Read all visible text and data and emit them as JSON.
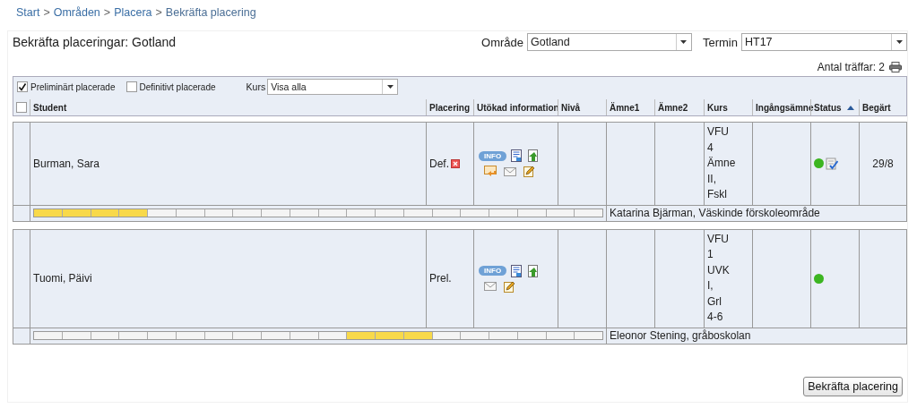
{
  "breadcrumb": [
    {
      "label": "Start",
      "link": true
    },
    {
      "separator": ">",
      "label": "Områden",
      "link": true
    },
    {
      "separator": ">",
      "label": "Placera",
      "link": true
    },
    {
      "separator": ">",
      "label": "Bekräfta placering",
      "link": false
    }
  ],
  "page_title": "Bekräfta placeringar: Gotland",
  "filters": [
    {
      "label": "Område",
      "value": "Gotland"
    },
    {
      "label": "Termin",
      "value": "HT17"
    }
  ],
  "hit_count": "Antal träffar: 2",
  "options": [
    {
      "label": "Preliminärt placerade",
      "checked": true
    },
    {
      "label": "Definitivt placerade",
      "checked": false
    }
  ],
  "course_filter": {
    "label": "Kurs",
    "value": "Visa alla"
  },
  "table": {
    "select_all": {
      "checked": false
    },
    "columns": [
      {
        "label": "Student",
        "sorted": false
      },
      {
        "label": "Placering",
        "sorted": false
      },
      {
        "label": "Utökad information",
        "sorted": false
      },
      {
        "label": "Nivå",
        "sorted": false
      },
      {
        "label": "Ämne1",
        "sorted": false
      },
      {
        "label": "Ämne2",
        "sorted": false
      },
      {
        "label": "Kurs",
        "sorted": false
      },
      {
        "label": "Ingångsämne",
        "sorted": false
      },
      {
        "label": "Status",
        "sorted": true
      },
      {
        "label": "Begärt",
        "sorted": false
      }
    ],
    "rows": [
      {
        "student": "Burman, Sara",
        "placement": "Def.",
        "removable": true,
        "info_badge": "INFO",
        "actions": [
          {
            "kind": "document"
          },
          {
            "kind": "import"
          },
          {
            "kind": "reply"
          },
          {
            "kind": "mail"
          },
          {
            "kind": "edit"
          }
        ],
        "course": [
          "VFU",
          "4",
          "Ämne",
          "II,",
          "Fskl"
        ],
        "status": {
          "color": "#3cb521",
          "confirmed": true
        },
        "requested": "29/8",
        "weeks": [
          {
            "filled": true
          },
          {
            "filled": true
          },
          {
            "filled": true
          },
          {
            "filled": true
          },
          {
            "filled": false
          },
          {
            "filled": false
          },
          {
            "filled": false
          },
          {
            "filled": false
          },
          {
            "filled": false
          },
          {
            "filled": false
          },
          {
            "filled": false
          },
          {
            "filled": false
          },
          {
            "filled": false
          },
          {
            "filled": false
          },
          {
            "filled": false
          },
          {
            "filled": false
          },
          {
            "filled": false
          },
          {
            "filled": false
          },
          {
            "filled": false
          },
          {
            "filled": false
          }
        ],
        "supervisor": "Katarina  Bjärman, Väskinde förskoleområde"
      },
      {
        "student": "Tuomi, Päivi",
        "placement": "Prel.",
        "removable": false,
        "info_badge": "INFO",
        "actions": [
          {
            "kind": "document"
          },
          {
            "kind": "import"
          },
          {
            "kind": "mail"
          },
          {
            "kind": "edit"
          }
        ],
        "course": [
          "VFU",
          "1",
          "UVK",
          "I,",
          "Grl",
          "4-6"
        ],
        "status": {
          "color": "#3cb521",
          "confirmed": false
        },
        "weeks": [
          {
            "filled": false
          },
          {
            "filled": false
          },
          {
            "filled": false
          },
          {
            "filled": false
          },
          {
            "filled": false
          },
          {
            "filled": false
          },
          {
            "filled": false
          },
          {
            "filled": false
          },
          {
            "filled": false
          },
          {
            "filled": false
          },
          {
            "filled": false
          },
          {
            "filled": true
          },
          {
            "filled": true
          },
          {
            "filled": true
          },
          {
            "filled": false
          },
          {
            "filled": false
          },
          {
            "filled": false
          },
          {
            "filled": false
          },
          {
            "filled": false
          },
          {
            "filled": false
          }
        ],
        "supervisor": "Eleonor Stening, gråboskolan"
      }
    ]
  },
  "confirm_button": "Bekräfta placering"
}
